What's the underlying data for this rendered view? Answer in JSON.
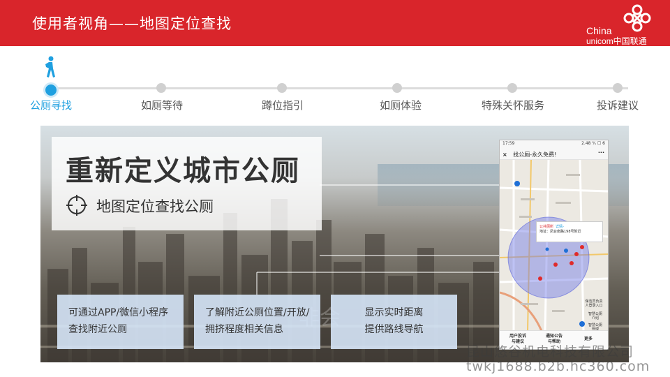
{
  "header": {
    "title": "使用者视角——地图定位查找",
    "logo_en_line1": "China",
    "logo_en_line2": "unicom中国联通"
  },
  "steps": [
    {
      "label": "公厕寻找",
      "active": true
    },
    {
      "label": "如厕等待",
      "active": false
    },
    {
      "label": "蹲位指引",
      "active": false
    },
    {
      "label": "如厕体验",
      "active": false
    },
    {
      "label": "特殊关怀服务",
      "active": false
    },
    {
      "label": "投诉建议",
      "active": false
    }
  ],
  "hero": {
    "headline": "重新定义城市公厕",
    "subline": "地图定位查找公厕",
    "faint_text": "非会"
  },
  "features": [
    {
      "line1": "可通过APP/微信小程序",
      "line2": "查找附近公厕"
    },
    {
      "line1": "了解附近公厕位置/开放/",
      "line2": "拥挤程度相关信息"
    },
    {
      "line1": "显示实时距离",
      "line2": "提供路线导航"
    }
  ],
  "phone": {
    "time": "17:59",
    "status_right": "2.48 ⁹⁄ₛ ☐ 6",
    "close": "×",
    "title": "找公厕-永久免费!",
    "menu": "···",
    "popup_name": "公共厕所",
    "popup_detail": "详情›",
    "popup_address": "地址：凤台南路198号附近",
    "side_item1": "保洁员负责人登录入口",
    "side_item2": "智慧公厕介绍",
    "side_item3": "智慧公厕管理",
    "tab1": "用户投诉\n与建议",
    "tab2": "通知公告\n与帮助",
    "tab3": "更多"
  },
  "watermark": {
    "line1": "昆山悠谷机电科技有限公司",
    "line2": "twkj1688.b2b.hc360.com"
  },
  "colors": {
    "header_red": "#d9252b",
    "accent_blue": "#1fa0e0",
    "feature_bg": "#d6e6f8"
  }
}
